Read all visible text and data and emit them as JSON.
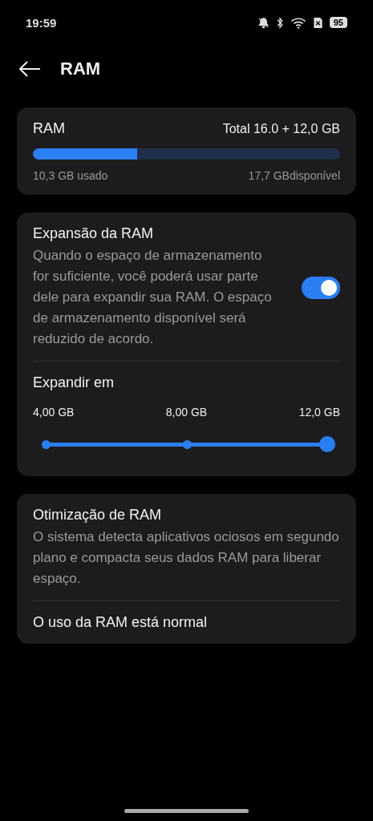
{
  "status_bar": {
    "time": "19:59",
    "battery": "95"
  },
  "header": {
    "title": "RAM"
  },
  "usage_card": {
    "title": "RAM",
    "total": "Total 16.0 + 12,0 GB",
    "level": 0.34,
    "used": "10,3 GB usado",
    "available": "17,7 GBdisponível"
  },
  "expansion_card": {
    "title": "Expansão da RAM",
    "description": "Quando o espaço de armazenamento for suficiente, você poderá usar parte dele para expandir sua RAM. O espaço de armazenamento disponível será reduzido de acordo.",
    "on": true,
    "expand_label": "Expandir em",
    "options": [
      "4,00 GB",
      "8,00 GB",
      "12,0 GB"
    ],
    "level": 1
  },
  "optimization_card": {
    "title": "Otimização de RAM",
    "description": "O sistema detecta aplicativos ociosos em segundo plano e compacta seus dados RAM para liberar espaço.",
    "status": "O uso da RAM está normal"
  }
}
